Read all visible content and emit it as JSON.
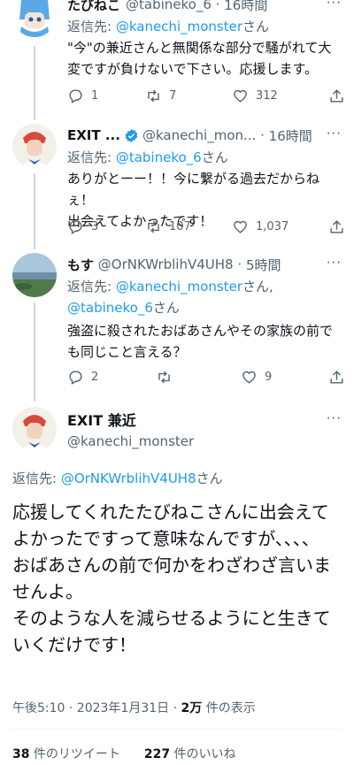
{
  "tweets": [
    {
      "name": "たびねこ",
      "handle": "@tabineko_6",
      "dot": "·",
      "time": "16時間",
      "reply_prefix": "返信先: ",
      "reply_to": "@kanechi_monster",
      "reply_suffix": "さん",
      "body": "\"今\"の兼近さんと無関係な部分で騒がれて大変ですが負けないで下さい。応援します。",
      "replies": "1",
      "retweets": "7",
      "likes": "312"
    },
    {
      "name": "EXIT ...",
      "handle": "@kanechi_mon...",
      "dot": "·",
      "time": "16時間",
      "reply_prefix": "返信先: ",
      "reply_to": "@tabineko_6",
      "reply_suffix": "さん",
      "body": "ありがとーー！！今に繋がる過去だからねぇ！\n出会えてよかったです！",
      "replies": "3",
      "retweets": "107",
      "likes": "1,037"
    },
    {
      "name": "もす",
      "handle": "@OrNKWrblihV4UH8",
      "dot": "·",
      "time": "5時間",
      "reply_prefix": "返信先: ",
      "reply_to": "@kanechi_monster",
      "reply_suffix": "さん,",
      "reply_to_2": "@tabineko_6",
      "reply_suffix_2": "さん",
      "body": "強盗に殺されたおばあさんやその家族の前でも同じこと言える？",
      "replies": "2",
      "retweets": "",
      "likes": "9"
    }
  ],
  "main": {
    "name": "EXIT 兼近",
    "handle": "@kanechi_monster",
    "reply_prefix": "返信先: ",
    "reply_to": "@OrNKWrblihV4UH8",
    "reply_suffix": "さん",
    "body": "応援してくれたたびねこさんに出会えてよかったですって意味なんですが、、、、\nおばあさんの前で何かをわざわざ言いませんよ。\nそのような人を減らせるようにと生きていくだけです！",
    "time": "午後5:10 · 2023年1月31日 · ",
    "views_count": "2万",
    "views_label": " 件の表示",
    "retweets_count": "38",
    "retweets_label": " 件のリツイート",
    "likes_count": "227",
    "likes_label": " 件のいいね"
  },
  "more_label": "···",
  "colors": {
    "accent": "#1d9bf0",
    "secondary_text": "#536471",
    "primary_text": "#0f1419",
    "verified": "#1d9bf0"
  }
}
